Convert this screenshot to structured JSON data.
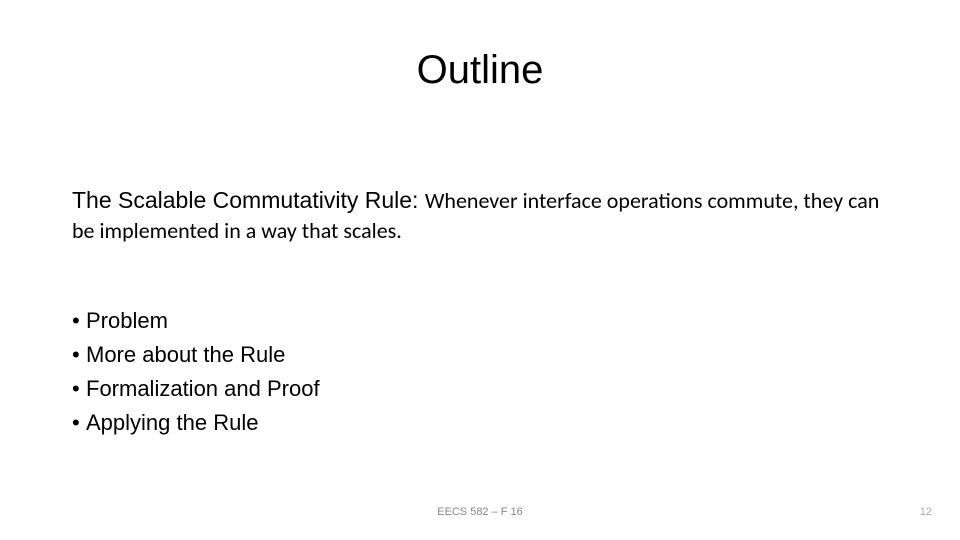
{
  "title": "Outline",
  "rule": {
    "prefix": "The Scalable Commutativity Rule: ",
    "body": "Whenever interface operations commute, they can be implemented in a way that scales."
  },
  "bullets": [
    "Problem",
    "More about the Rule",
    "Formalization and Proof",
    "Applying the Rule"
  ],
  "footer": {
    "center": "EECS 582 – F 16",
    "page": "12"
  }
}
